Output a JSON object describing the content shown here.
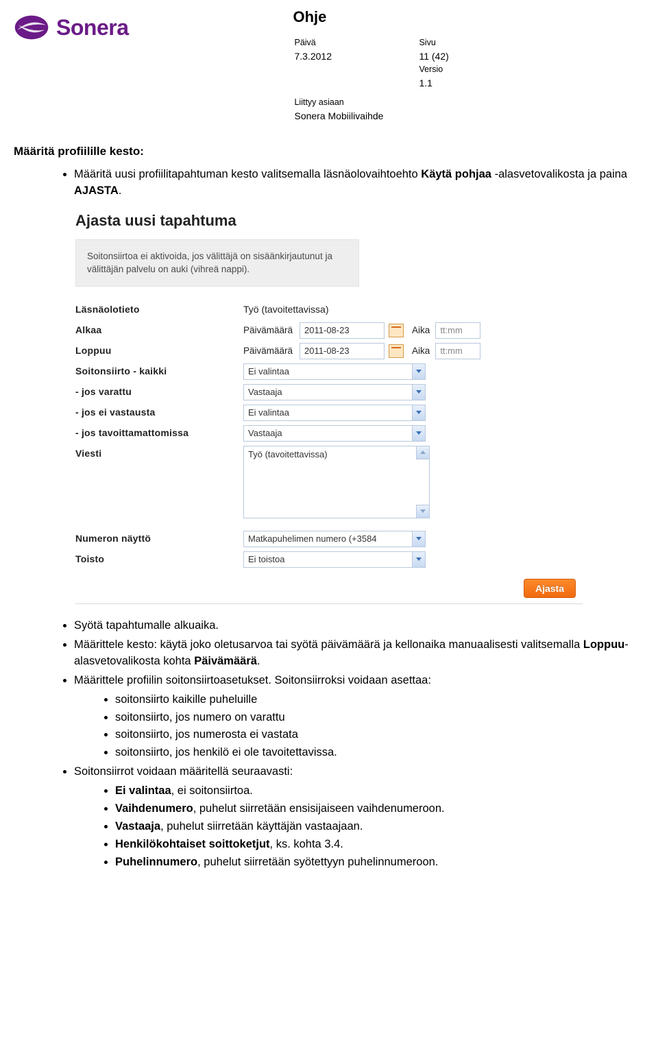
{
  "brand": {
    "name": "Sonera"
  },
  "header": {
    "title": "Ohje",
    "date_label": "Päivä",
    "date_value": "7.3.2012",
    "page_label": "Sivu",
    "page_value": "11 (42)",
    "version_label": "Versio",
    "version_value": "1.1",
    "relates_label": "Liittyy asiaan",
    "relates_value": "Sonera Mobiilivaihde"
  },
  "section_title": "Määritä profiilille kesto:",
  "intro_bullet": {
    "pre": "Määritä uusi profiilitapahtuman kesto valitsemalla läsnäolovaihtoehto ",
    "b1": "Käytä pohjaa",
    "mid": " -alasvetovalikosta ja paina ",
    "b2": "AJASTA",
    "post": "."
  },
  "embed": {
    "title": "Ajasta uusi tapahtuma",
    "notice": "Soitonsiirtoa ei aktivoida, jos välittäjä on sisäänkirjautunut ja välittäjän palvelu on auki (vihreä nappi).",
    "labels": {
      "presence": "Läsnäolotieto",
      "starts": "Alkaa",
      "ends": "Loppuu",
      "date_word": "Päivämäärä",
      "time_word": "Aika",
      "fwd_all": "Soitonsiirto - kaikki",
      "if_busy": "- jos varattu",
      "if_noanswer": "- jos ei vastausta",
      "if_unreach": "- jos tavoittamattomissa",
      "message": "Viesti",
      "number_display": "Numeron näyttö",
      "repeat": "Toisto"
    },
    "values": {
      "presence": "Työ (tavoitettavissa)",
      "date1": "2011-08-23",
      "date2": "2011-08-23",
      "time_placeholder": "tt:mm",
      "fwd_all": "Ei valintaa",
      "if_busy": "Vastaaja",
      "if_noanswer": "Ei valintaa",
      "if_unreach": "Vastaaja",
      "message": "Työ (tavoitettavissa)",
      "number_display": "Matkapuhelimen numero (+3584",
      "repeat": "Ei toistoa"
    },
    "button": "Ajasta"
  },
  "bullets_after": {
    "b1": "Syötä tapahtumalle alkuaika.",
    "b2_pre": "Määrittele kesto: käytä joko oletusarvoa tai syötä päivämäärä ja kellonaika manuaalisesti valitsemalla ",
    "b2_b1": "Loppuu",
    "b2_mid": "-alasvetovalikosta kohta ",
    "b2_b2": "Päivämäärä",
    "b2_post": ".",
    "b3": "Määrittele profiilin soitonsiirtoasetukset. Soitonsiirroksi voidaan asettaa:",
    "b3_sub": [
      "soitonsiirto kaikille puheluille",
      "soitonsiirto, jos numero on varattu",
      "soitonsiirto, jos numerosta ei vastata",
      "soitonsiirto, jos henkilö ei ole tavoitettavissa."
    ],
    "b4": "Soitonsiirrot voidaan määritellä seuraavasti:",
    "b4_sub": [
      {
        "b": "Ei valintaa",
        "t": ", ei soitonsiirtoa."
      },
      {
        "b": "Vaihdenumero",
        "t": ", puhelut siirretään ensisijaiseen vaihdenumeroon."
      },
      {
        "b": "Vastaaja",
        "t": ", puhelut siirretään käyttäjän vastaajaan."
      },
      {
        "b": "Henkilökohtaiset soittoketjut",
        "t": ", ks. kohta 3.4."
      },
      {
        "b": "Puhelinnumero",
        "t": ", puhelut siirretään syötettyyn puhelinnumeroon."
      }
    ]
  }
}
